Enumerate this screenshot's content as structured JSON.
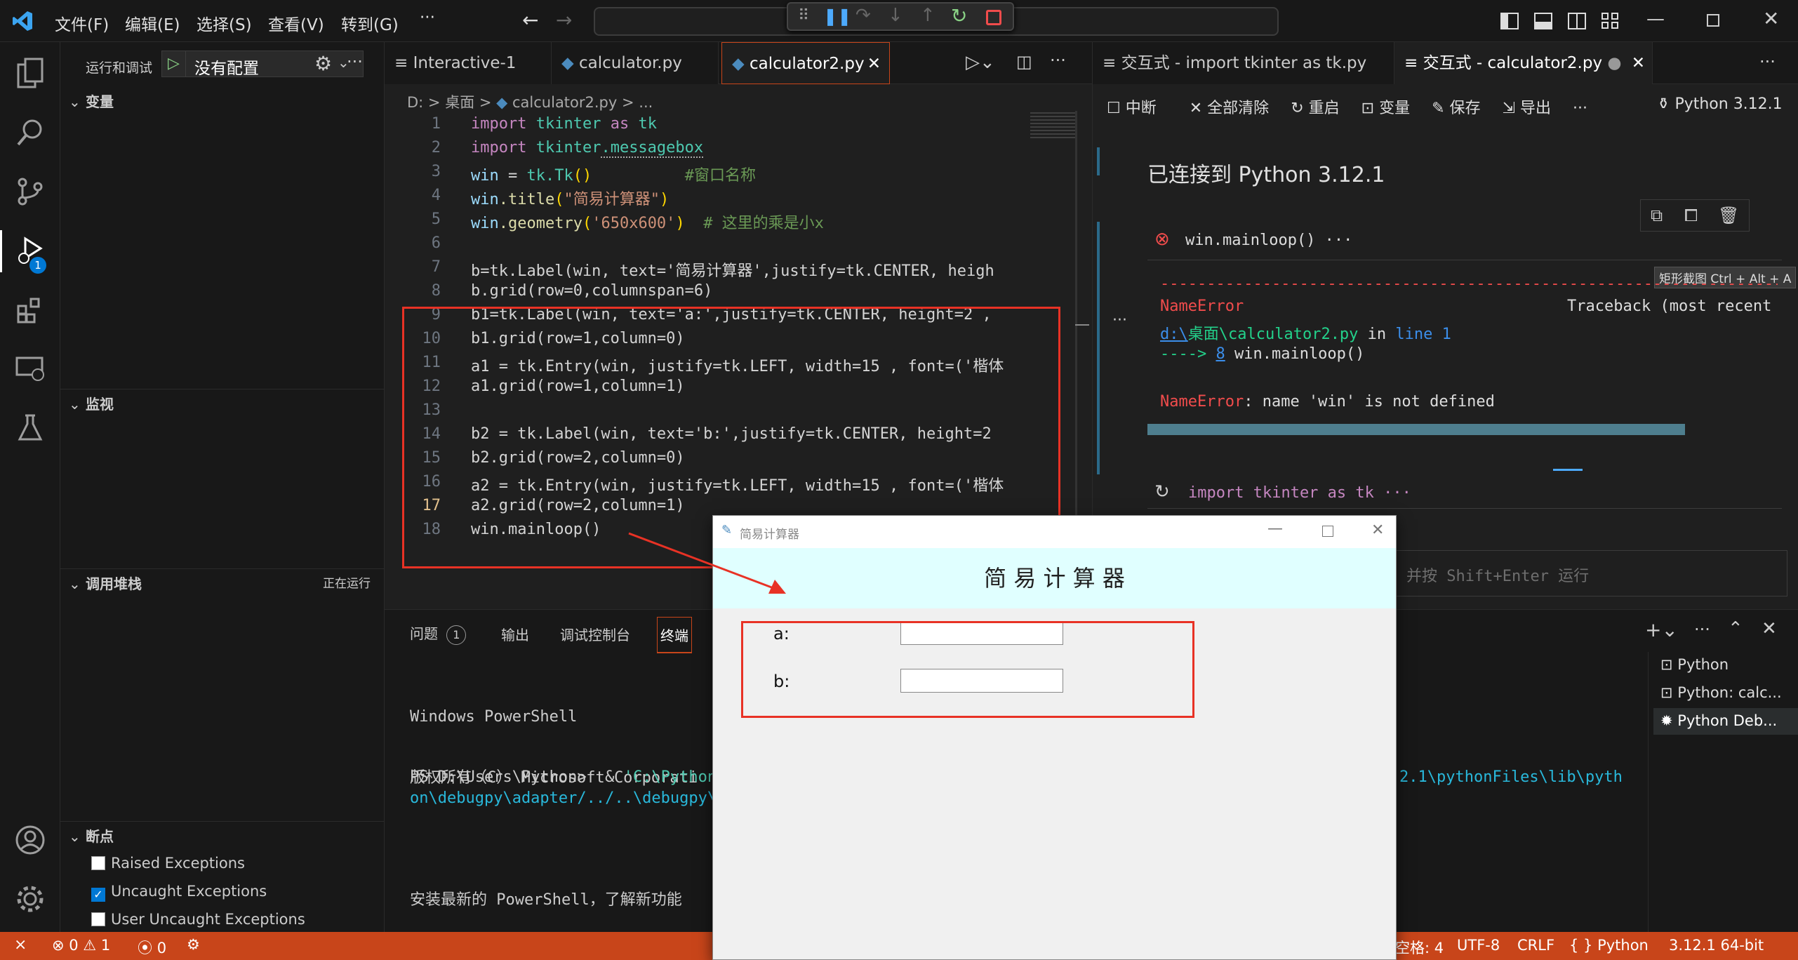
{
  "titlebar": {
    "menu": [
      "文件(F)",
      "编辑(E)",
      "选择(S)",
      "查看(V)",
      "转到(G)"
    ],
    "more": "···"
  },
  "debug_toolbar": {
    "icons": [
      "drag-icon",
      "pause-icon",
      "step-over-icon",
      "step-into-icon",
      "step-out-icon",
      "restart-icon",
      "stop-icon"
    ]
  },
  "sidebar": {
    "title": "运行和调试",
    "config": "没有配置",
    "sections": {
      "variables": "变量",
      "watch": "监视",
      "callstack": "调用堆栈",
      "callstack_status": "正在运行",
      "breakpoints": "断点"
    },
    "breakpoints": [
      {
        "label": "Raised Exceptions",
        "checked": false
      },
      {
        "label": "Uncaught Exceptions",
        "checked": true
      },
      {
        "label": "User Uncaught Exceptions",
        "checked": false
      }
    ],
    "debug_badge": "1"
  },
  "editor": {
    "tabs": [
      {
        "label": "Interactive-1",
        "icon": "list-icon"
      },
      {
        "label": "calculator.py",
        "icon": "python-icon"
      },
      {
        "label": "calculator2.py",
        "icon": "python-icon",
        "active": true
      }
    ],
    "breadcrumb": [
      "D:",
      "桌面",
      "calculator2.py",
      "..."
    ],
    "lines": [
      {
        "n": "1"
      },
      {
        "n": "2"
      },
      {
        "n": "3"
      },
      {
        "n": "4"
      },
      {
        "n": "5"
      },
      {
        "n": "6"
      },
      {
        "n": "7"
      },
      {
        "n": "8"
      },
      {
        "n": "9"
      },
      {
        "n": "10"
      },
      {
        "n": "11"
      },
      {
        "n": "12"
      },
      {
        "n": "13"
      },
      {
        "n": "14"
      },
      {
        "n": "15"
      },
      {
        "n": "16"
      },
      {
        "n": "17"
      },
      {
        "n": "18"
      }
    ],
    "code": {
      "l1a": "import",
      "l1b": "tkinter",
      "l1c": "as",
      "l1d": "tk",
      "l2a": "import",
      "l2b": "tkinter",
      "l2c": ".messagebox",
      "l3a": "win",
      "l3b": " = ",
      "l3c": "tk",
      "l3d": ".Tk",
      "l3e": "()",
      "l3f": "          #窗口名称",
      "l4a": "win",
      "l4b": ".title",
      "l4c": "(",
      "l4d": "\"简易计算器\"",
      "l4e": ")",
      "l5a": "win",
      "l5b": ".geometry",
      "l5c": "(",
      "l5d": "'650x600'",
      "l5e": ")  ",
      "l5f": "# 这里的乘是小x",
      "l7": "b=tk.Label(win, text='简易计算器',justify=tk.CENTER, heigh",
      "l8": "b.grid(row=0,columnspan=6)",
      "l9": "b1=tk.Label(win, text='a:',justify=tk.CENTER, height=2 ,",
      "l10": "b1.grid(row=1,column=0)",
      "l11": "a1 = tk.Entry(win, justify=tk.LEFT, width=15 , font=('楷体",
      "l12": "a1.grid(row=1,column=1)",
      "l14": "b2 = tk.Label(win, text='b:',justify=tk.CENTER, height=2",
      "l15": "b2.grid(row=2,column=0)",
      "l16": "a2 = tk.Entry(win, justify=tk.LEFT, width=15 , font=('楷体",
      "l17": "a2.grid(row=2,column=1)",
      "l18": "win.mainloop()"
    }
  },
  "interactive": {
    "tabs": [
      {
        "label": "交互式 - import tkinter as tk.py"
      },
      {
        "label": "交互式 - calculator2.py",
        "dirty": "●"
      }
    ],
    "toolbar": [
      "中断",
      "全部清除",
      "重启",
      "变量",
      "保存",
      "导出"
    ],
    "kernel": "Python 3.12.1",
    "more": "···",
    "connected": "已连接到 Python 3.12.1",
    "cell1": "win.mainloop() ···",
    "tooltip": "矩形截图 Ctrl + Alt + A",
    "error": {
      "dashes": "---------------------------------------------------------------------------",
      "name": "NameError",
      "traceback": "Traceback (most recent",
      "path_drive": "d:\\",
      "path_rest": "桌面\\calculator2.py",
      "in_word": " in ",
      "line_word": "line 1",
      "arrow": "----> ",
      "arrow_num": "8",
      "arrow_code": " win.mainloop()",
      "msg_name": "NameError",
      "msg": ": name 'win' is not defined"
    },
    "cell2": "import tkinter as tk ···",
    "input_hint": "并按 Shift+Enter 运行"
  },
  "panel": {
    "tabs": [
      "问题",
      "输出",
      "调试控制台",
      "终端"
    ],
    "problems_badge": "1",
    "terminal_lines": [
      "Windows PowerShell",
      "版权所有（C） Microsoft Corporati",
      "",
      "安装最新的 PowerShell，了解新功能"
    ],
    "prompt": "PS D:\\Users\\Python>  & ",
    "cmd_part1": "'C:\\Python",
    "cmd_part2": "2.1\\pythonFiles\\lib\\pyth",
    "cmd_line2": "on\\debugpy\\adapter/../..\\debugpy\\",
    "terminals": [
      "Python",
      "Python: calc...",
      "Python Deb..."
    ]
  },
  "tkwindow": {
    "title": "简易计算器",
    "heading": "简 易 计 算 器",
    "label_a": "a:",
    "label_b": "b:"
  },
  "statusbar": {
    "errors": "0",
    "warnings": "1",
    "ports": "0",
    "spaces": "空格: 4",
    "encoding": "UTF-8",
    "eol": "CRLF",
    "language": "Python",
    "interpreter": "3.12.1 64-bit"
  },
  "colors": {
    "accent": "#c8451a",
    "highlight_box": "#e83225",
    "tk_heading_bg": "#e0ffff"
  }
}
